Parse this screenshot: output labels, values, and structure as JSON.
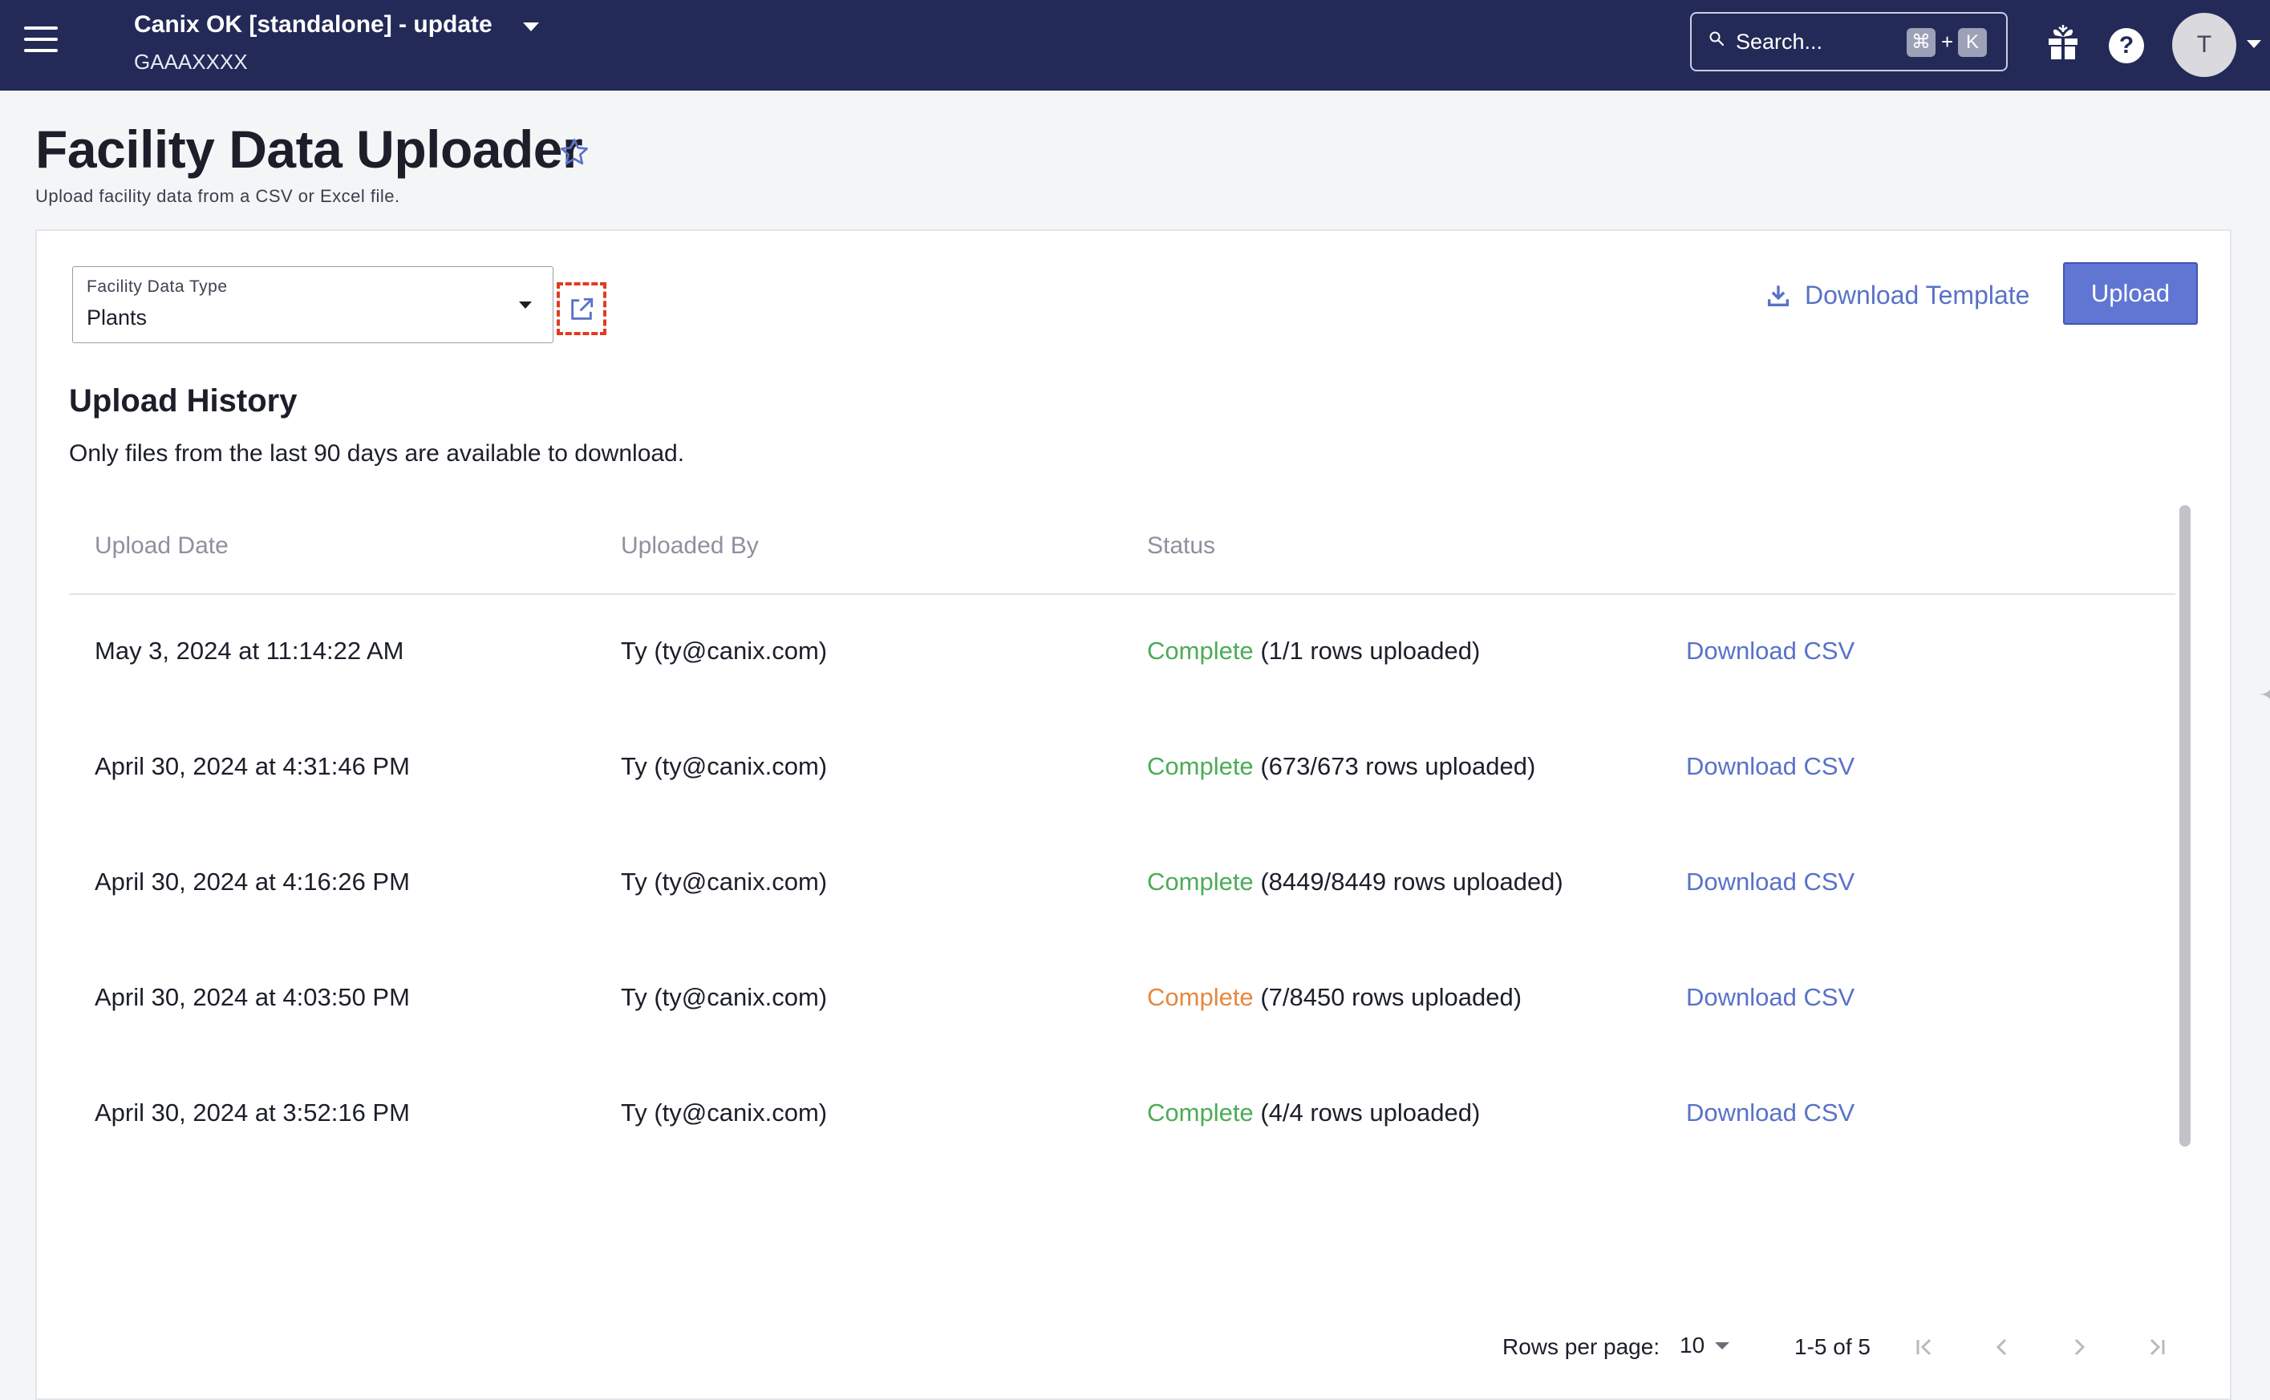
{
  "topbar": {
    "org_name": "Canix OK [standalone] - update",
    "org_code": "GAAAXXXX",
    "search_placeholder": "Search...",
    "shortcut_cmd": "⌘",
    "shortcut_plus": "+",
    "shortcut_key": "K",
    "help_label": "?",
    "avatar_initial": "T",
    "background_color": "#232a57"
  },
  "header": {
    "title": "Facility Data Uploader",
    "subtitle": "Upload facility data from a CSV or Excel file."
  },
  "toolbar": {
    "data_type_label": "Facility Data Type",
    "data_type_value": "Plants",
    "download_template_label": "Download Template",
    "upload_label": "Upload"
  },
  "history": {
    "title": "Upload History",
    "note": "Only files from the last 90 days are available to download.",
    "columns": [
      "Upload Date",
      "Uploaded By",
      "Status"
    ],
    "rows": [
      {
        "date": "May 3, 2024 at 11:14:22 AM",
        "by": "Ty (ty@canix.com)",
        "status": "Complete",
        "detail": "(1/1 rows uploaded)",
        "status_color": "#4cac56",
        "action": "Download CSV"
      },
      {
        "date": "April 30, 2024 at 4:31:46 PM",
        "by": "Ty (ty@canix.com)",
        "status": "Complete",
        "detail": "(673/673 rows uploaded)",
        "status_color": "#4cac56",
        "action": "Download CSV"
      },
      {
        "date": "April 30, 2024 at 4:16:26 PM",
        "by": "Ty (ty@canix.com)",
        "status": "Complete",
        "detail": "(8449/8449 rows uploaded)",
        "status_color": "#4cac56",
        "action": "Download CSV"
      },
      {
        "date": "April 30, 2024 at 4:03:50 PM",
        "by": "Ty (ty@canix.com)",
        "status": "Complete",
        "detail": "(7/8450 rows uploaded)",
        "status_color": "#e8873f",
        "action": "Download CSV"
      },
      {
        "date": "April 30, 2024 at 3:52:16 PM",
        "by": "Ty (ty@canix.com)",
        "status": "Complete",
        "detail": "(4/4 rows uploaded)",
        "status_color": "#4cac56",
        "action": "Download CSV"
      }
    ]
  },
  "pagination": {
    "rows_per_page_label": "Rows per page:",
    "rows_per_page_value": "10",
    "range_label": "1-5 of 5"
  },
  "colors": {
    "accent": "#6176d3",
    "link": "#5972c8",
    "success": "#4cac56",
    "warning": "#e8873f",
    "highlight_dashed": "#e23b20"
  }
}
